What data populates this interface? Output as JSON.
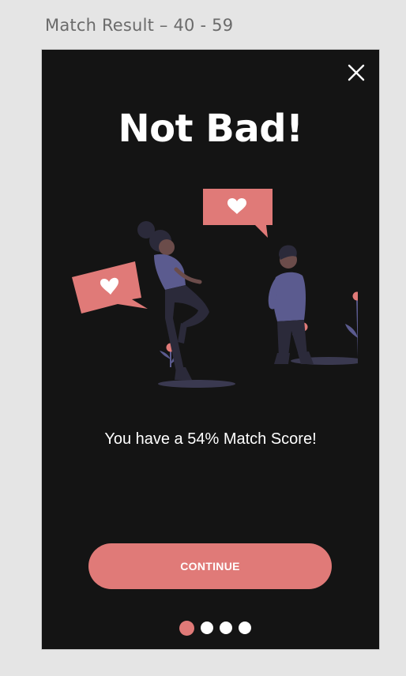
{
  "artboard": {
    "title": "Match Result – 40 - 59"
  },
  "screen": {
    "close_icon": "close-icon",
    "heading": "Not Bad!",
    "illustration": "couple-chatting-hearts-illustration",
    "score_message": "You have a 54% Match Score!",
    "score_percent": 54,
    "continue_label": "CONTINUE",
    "pager": {
      "total": 4,
      "active_index": 0
    }
  },
  "colors": {
    "background": "#141414",
    "accent": "#e07a78",
    "text": "#ffffff",
    "figure_shirt": "#5b5b8f",
    "figure_pants": "#2b2a3a"
  }
}
